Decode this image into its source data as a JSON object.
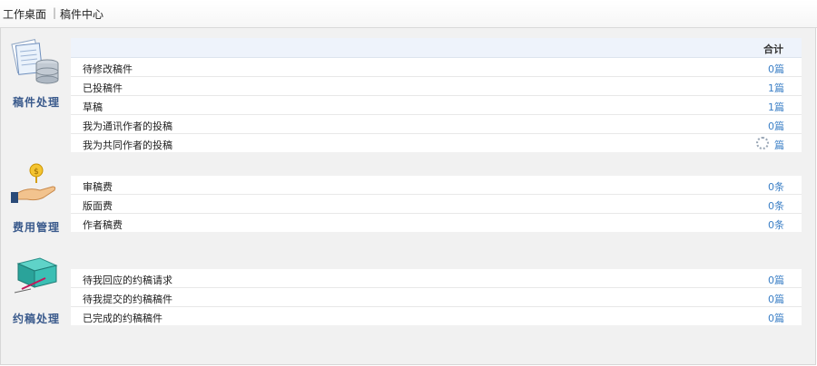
{
  "breadcrumb": {
    "home": "工作桌面",
    "separator": "|",
    "current": "稿件中心"
  },
  "sections": {
    "manuscript": {
      "title": "稿件处理",
      "header_total": "合计",
      "rows": [
        {
          "label": "待修改稿件",
          "value": "0篇"
        },
        {
          "label": "已投稿件",
          "value": "1篇"
        },
        {
          "label": "草稿",
          "value": "1篇"
        },
        {
          "label": "我为通讯作者的投稿",
          "value": "0篇"
        },
        {
          "label": "我为共同作者的投稿",
          "value": "篇"
        }
      ]
    },
    "fees": {
      "title": "费用管理",
      "rows": [
        {
          "label": "审稿费",
          "value": "0条"
        },
        {
          "label": "版面费",
          "value": "0条"
        },
        {
          "label": "作者稿费",
          "value": "0条"
        }
      ]
    },
    "invited": {
      "title": "约稿处理",
      "rows": [
        {
          "label": "待我回应的约稿请求",
          "value": "0篇"
        },
        {
          "label": "待我提交的约稿稿件",
          "value": "0篇"
        },
        {
          "label": "已完成的约稿稿件",
          "value": "0篇"
        }
      ]
    }
  },
  "icons": {
    "manuscript": "document-database-icon",
    "fees": "hand-coin-icon",
    "invited": "box-pen-icon"
  },
  "colors": {
    "accent": "#3b7fc6",
    "section_title": "#3a5a8c"
  }
}
